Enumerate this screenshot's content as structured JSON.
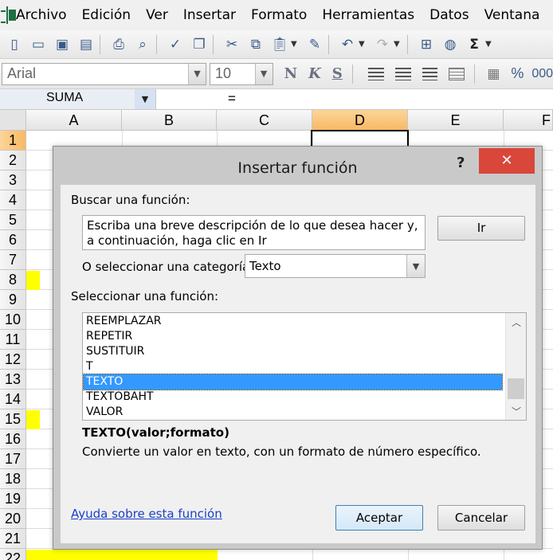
{
  "menubar": {
    "icon": "excel-app-icon",
    "items": [
      {
        "label": "Archivo"
      },
      {
        "label": "Edición"
      },
      {
        "label": "Ver"
      },
      {
        "label": "Insertar"
      },
      {
        "label": "Formato"
      },
      {
        "label": "Herramientas"
      },
      {
        "label": "Datos"
      },
      {
        "label": "Ventana"
      },
      {
        "label": "?"
      }
    ]
  },
  "toolbar": {
    "standard_icons": [
      "new-icon",
      "open-icon",
      "save-icon",
      "permission-icon",
      "print-icon",
      "print-preview-icon",
      "spelling-icon",
      "research-icon",
      "cut-icon",
      "copy-icon",
      "paste-icon",
      "format-painter-icon",
      "undo-icon",
      "redo-icon",
      "insert-hyperlink-icon",
      "autosum-icon"
    ],
    "autosum_glyph": "Σ",
    "font_name": "Arial",
    "font_size": "10",
    "bold_label": "N",
    "italic_label": "K",
    "underline_label": "S",
    "percent_label": "%",
    "thousands_label": "000"
  },
  "formula_bar": {
    "name_box": "SUMA",
    "content": "="
  },
  "sheet": {
    "columns": [
      "A",
      "B",
      "C",
      "D",
      "E",
      "F"
    ],
    "selected_column": "D",
    "rows": [
      "1",
      "2",
      "3",
      "4",
      "5",
      "6",
      "7",
      "8",
      "9",
      "10",
      "11",
      "12",
      "13",
      "14",
      "15",
      "16",
      "17",
      "18",
      "19",
      "20",
      "21",
      "22"
    ],
    "selected_row": "1",
    "highlight_color": "#ffff00",
    "selection_header_color": "#f8b964"
  },
  "dialog": {
    "title": "Insertar función",
    "help_glyph": "?",
    "close_glyph": "✕",
    "search_label": "Buscar una función:",
    "search_text": "Escriba una breve descripción de lo que desea hacer y, a continuación, haga clic en Ir",
    "go_button": "Ir",
    "category_label": "O seleccionar una categoría:",
    "category_value": "Texto",
    "function_list_label": "Seleccionar una función:",
    "functions": [
      {
        "name": "REEMPLAZAR",
        "selected": false
      },
      {
        "name": "REPETIR",
        "selected": false
      },
      {
        "name": "SUSTITUIR",
        "selected": false
      },
      {
        "name": "T",
        "selected": false
      },
      {
        "name": "TEXTO",
        "selected": true
      },
      {
        "name": "TEXTOBAHT",
        "selected": false
      },
      {
        "name": "VALOR",
        "selected": false
      }
    ],
    "syntax": "TEXTO(valor;formato)",
    "description": "Convierte un valor en texto, con un formato de número específico.",
    "help_link": "Ayuda sobre esta función",
    "ok_button": "Aceptar",
    "cancel_button": "Cancelar",
    "close_color": "#d9463a",
    "selection_color": "#3399ff",
    "link_color": "#1a3fc8"
  }
}
